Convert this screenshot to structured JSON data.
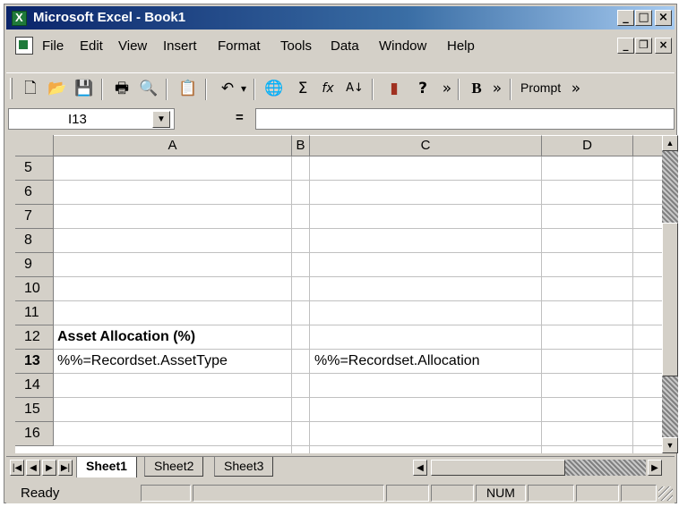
{
  "window": {
    "title": "Microsoft Excel - Book1"
  },
  "title_buttons": {
    "minimize": "_",
    "restore": "□",
    "close": "×"
  },
  "menu": {
    "items": [
      "File",
      "Edit",
      "View",
      "Insert",
      "Format",
      "Tools",
      "Data",
      "Window",
      "Help"
    ]
  },
  "doc_buttons": {
    "minimize": "_",
    "restore": "❐",
    "close": "×"
  },
  "toolbar": {
    "icons": [
      "new-icon",
      "open-icon",
      "save-icon",
      "print-icon",
      "print-preview-icon",
      "paste-icon",
      "undo-icon",
      "web-icon",
      "autosum-icon",
      "function-icon",
      "sort-ascending-icon",
      "chart-wizard-icon",
      "help-icon",
      "more-icon",
      "bold-icon",
      "more-icon"
    ],
    "glyphs": {
      "new": "🗋",
      "open": "📂",
      "save": "💾",
      "print": "🖶",
      "preview": "🔍",
      "paste": "📋",
      "undo": "↶",
      "dropdown": "▾",
      "web": "🌐",
      "autosum": "Σ",
      "function": "fx",
      "sort": "A↓",
      "chart": "▮",
      "help": "?",
      "more": "»",
      "bold": "B"
    },
    "prompt_label": "Prompt"
  },
  "formula_bar": {
    "name_box": "I13",
    "equals": "=",
    "formula": ""
  },
  "grid": {
    "columns": [
      "A",
      "B",
      "C",
      "D"
    ],
    "rows": [
      "5",
      "6",
      "7",
      "8",
      "9",
      "10",
      "11",
      "12",
      "13",
      "14",
      "15",
      "16"
    ],
    "active_row": "13",
    "cells": {
      "A12": "Asset Allocation (%)",
      "A13": "%%=Recordset.AssetType",
      "C13": "%%=Recordset.Allocation"
    }
  },
  "sheet_tabs": {
    "tabs": [
      "Sheet1",
      "Sheet2",
      "Sheet3"
    ],
    "active": "Sheet1"
  },
  "status_bar": {
    "status": "Ready",
    "num": "NUM"
  }
}
